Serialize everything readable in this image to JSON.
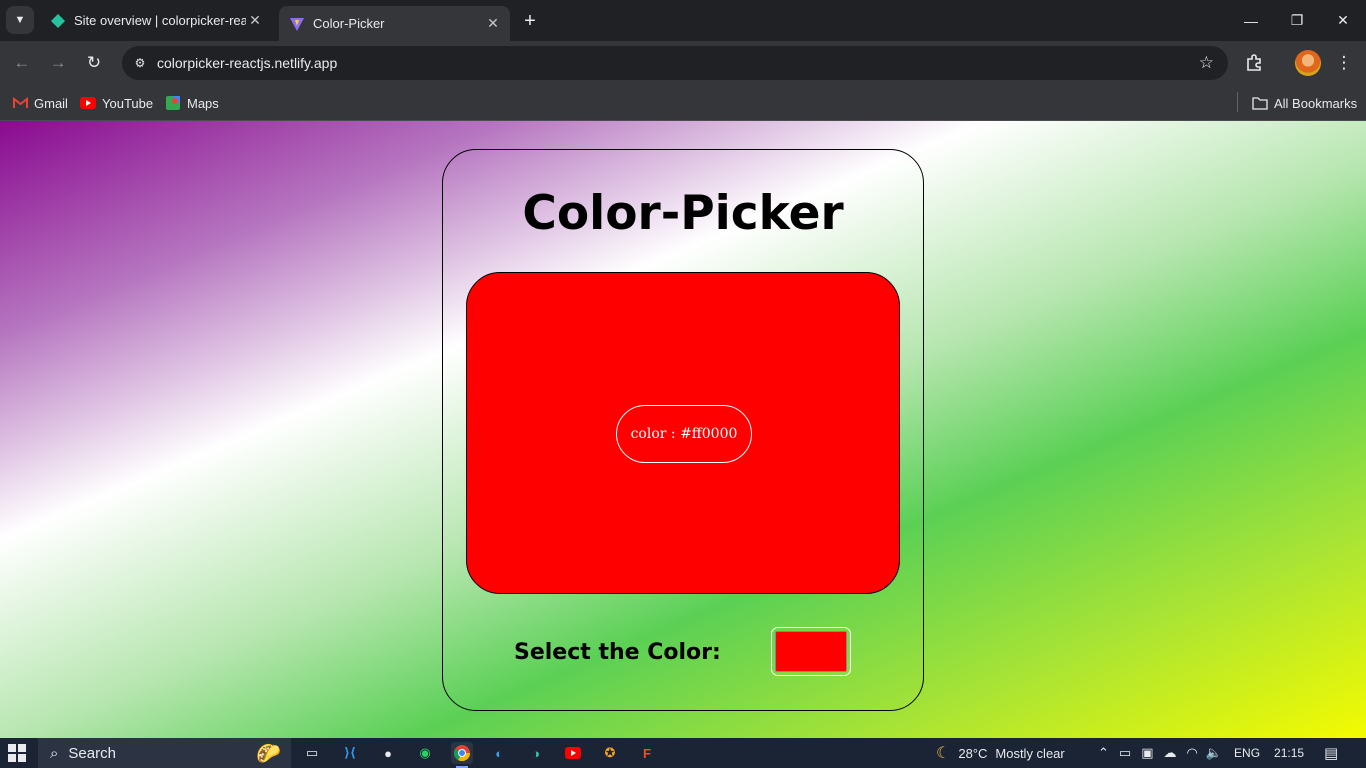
{
  "browser": {
    "tabs": [
      {
        "title": "Site overview | colorpicker-react",
        "favicon": "netlify-icon",
        "active": false
      },
      {
        "title": "Color-Picker",
        "favicon": "vite-icon",
        "active": true
      }
    ],
    "url": "colorpicker-reactjs.netlify.app",
    "bookmarks": [
      {
        "label": "Gmail",
        "icon": "gmail-icon"
      },
      {
        "label": "YouTube",
        "icon": "youtube-icon"
      },
      {
        "label": "Maps",
        "icon": "maps-icon"
      }
    ],
    "all_bookmarks_label": "All Bookmarks"
  },
  "app": {
    "title": "Color-Picker",
    "preview_color": "#ff0000",
    "color_label": "color : #ff0000",
    "select_label": "Select the Color:",
    "input_value": "#ff0000"
  },
  "colors": {
    "browser_frame": "#202124",
    "toolbar": "#35363a",
    "gradient": [
      "#8a0a90",
      "#ffffff",
      "#5bd055",
      "#f4fb00"
    ]
  },
  "taskbar": {
    "search_placeholder": "Search",
    "pinned": [
      "task-view-icon",
      "vscode-icon",
      "github-icon",
      "whatsapp-icon",
      "chrome-icon",
      "edge-icon",
      "edge-icon",
      "youtube-icon",
      "badge-app-icon",
      "figma-icon"
    ],
    "weather": {
      "temp": "28°C",
      "condition": "Mostly clear"
    },
    "language": "ENG",
    "time": "21:15"
  }
}
